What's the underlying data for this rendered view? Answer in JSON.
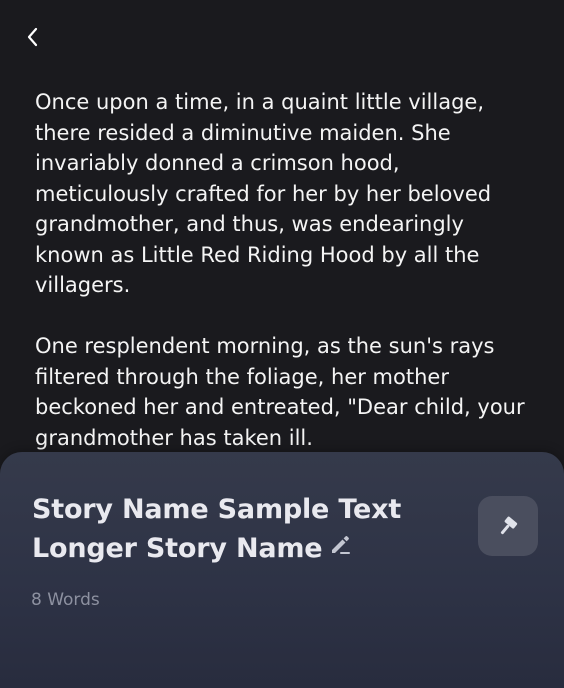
{
  "header": {
    "back_icon": "chevron-left-icon"
  },
  "story": {
    "paragraphs": [
      "Once upon a time, in a quaint little village, there resided a diminutive maiden. She invariably donned a crimson hood, meticulously crafted for her by her beloved grandmother, and thus, was endearingly known as Little Red Riding Hood by all the villagers.",
      "One resplendent morning, as the sun's rays filtered through the foliage, her mother beckoned her and entreated, \"Dear child, your grandmother has taken ill."
    ]
  },
  "sheet": {
    "title_line1": "Story Name Sample Text",
    "title_line2": "Longer Story Name",
    "edit_icon": "pencil-icon",
    "word_count": "8 Words",
    "tool_icon": "hammer-icon",
    "colors": {
      "background_top": "#353a4b",
      "tool_button": "#4a4e5e",
      "word_count_text": "#8d91a0"
    }
  }
}
